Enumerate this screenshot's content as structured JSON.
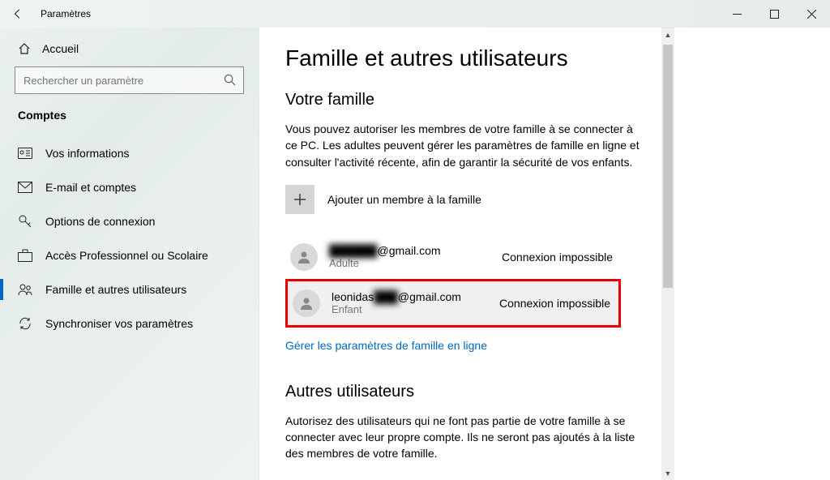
{
  "titlebar": {
    "title": "Paramètres"
  },
  "sidebar": {
    "home": "Accueil",
    "search_placeholder": "Rechercher un paramètre",
    "category": "Comptes",
    "items": [
      {
        "label": "Vos informations"
      },
      {
        "label": "E-mail et comptes"
      },
      {
        "label": "Options de connexion"
      },
      {
        "label": "Accès Professionnel ou Scolaire"
      },
      {
        "label": "Famille et autres utilisateurs"
      },
      {
        "label": "Synchroniser vos paramètres"
      }
    ]
  },
  "main": {
    "heading": "Famille et autres utilisateurs",
    "family_section_title": "Votre famille",
    "family_desc": "Vous pouvez autoriser les membres de votre famille à se connecter à ce PC. Les adultes peuvent gérer les paramètres de famille en ligne et consulter l'activité récente, afin de garantir la sécurité de vos enfants.",
    "add_member_label": "Ajouter un membre à la famille",
    "members": [
      {
        "email_redacted": "██████",
        "email_visible": "@gmail.com",
        "role": "Adulte",
        "status": "Connexion impossible"
      },
      {
        "email_prefix": "leonidas",
        "email_redacted": "███",
        "email_visible": "@gmail.com",
        "role": "Enfant",
        "status": "Connexion impossible"
      }
    ],
    "manage_link": "Gérer les paramètres de famille en ligne",
    "other_section_title": "Autres utilisateurs",
    "other_desc": "Autorisez des utilisateurs qui ne font pas partie de votre famille à se connecter avec leur propre compte. Ils ne seront pas ajoutés à la liste des membres de votre famille."
  }
}
